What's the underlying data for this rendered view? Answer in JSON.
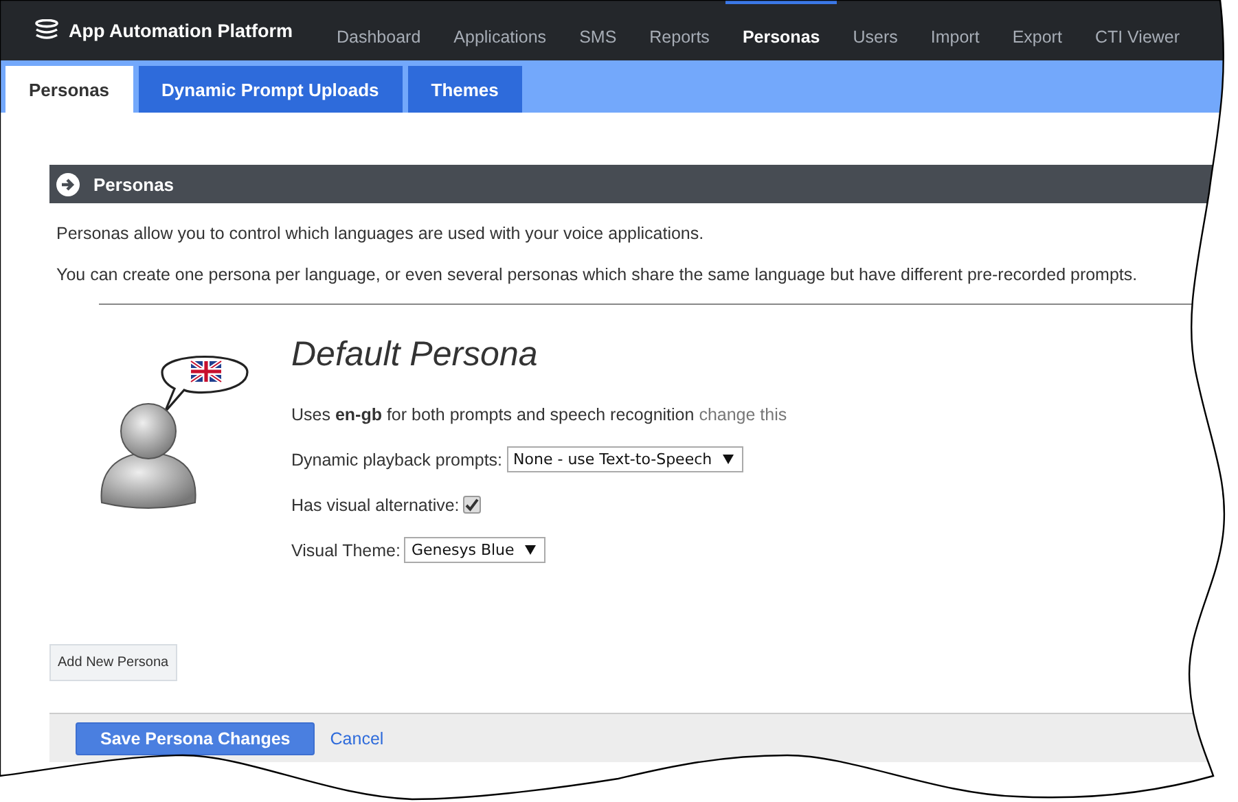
{
  "app": {
    "title": "App Automation Platform"
  },
  "nav": [
    {
      "label": "Dashboard",
      "selected": false
    },
    {
      "label": "Applications",
      "selected": false
    },
    {
      "label": "SMS",
      "selected": false
    },
    {
      "label": "Reports",
      "selected": false
    },
    {
      "label": "Personas",
      "selected": true
    },
    {
      "label": "Users",
      "selected": false
    },
    {
      "label": "Import",
      "selected": false
    },
    {
      "label": "Export",
      "selected": false
    },
    {
      "label": "CTI Viewer",
      "selected": false
    }
  ],
  "tabs": [
    {
      "label": "Personas",
      "selected": true
    },
    {
      "label": "Dynamic Prompt Uploads",
      "selected": false
    },
    {
      "label": "Themes",
      "selected": false
    }
  ],
  "section": {
    "title": "Personas",
    "intro": [
      "Personas allow you to control which languages are used with your voice applications.",
      "You can create one persona per language, or even several personas which share the same language but have different pre-recorded prompts."
    ]
  },
  "persona": {
    "name": "Default Persona",
    "language_text": "Uses **en-gb** for both prompts and speech recognition",
    "change_link": "change this",
    "fields": [
      {
        "kind": "select",
        "label": "Dynamic playback prompts:",
        "value": "None - use Text-to-Speech"
      },
      {
        "kind": "checkbox",
        "label": "Has visual alternative:",
        "checked": true
      },
      {
        "kind": "select",
        "label": "Visual Theme:",
        "value": "Genesys Blue"
      }
    ]
  },
  "add_button": "Add New Persona",
  "footer": {
    "save": "Save Persona Changes",
    "cancel": "Cancel"
  }
}
